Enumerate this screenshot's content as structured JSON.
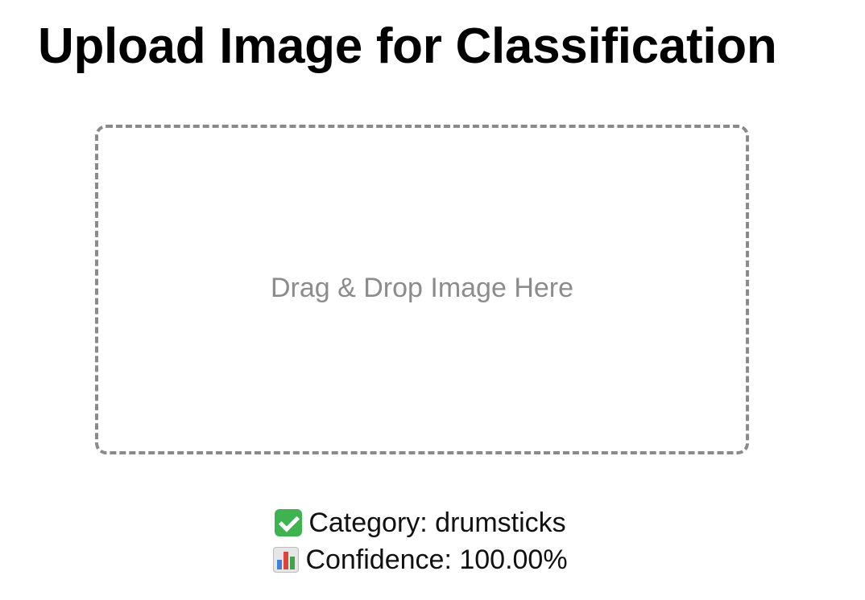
{
  "page": {
    "title": "Upload Image for Classification"
  },
  "upload": {
    "drop_text": "Drag & Drop Image Here"
  },
  "result": {
    "category_icon": "check-icon",
    "category_text": "Category: drumsticks",
    "confidence_icon": "bar-chart-icon",
    "confidence_text": "Confidence: 100.00%"
  },
  "colors": {
    "dashed_border": "#8a8a8a",
    "check_green": "#3fb34f"
  }
}
